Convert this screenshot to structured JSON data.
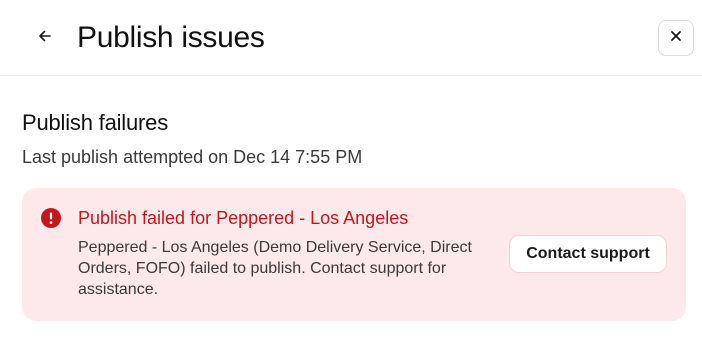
{
  "header": {
    "back_icon": "arrow-left-icon",
    "title": "Publish issues",
    "close_icon": "close-icon"
  },
  "section": {
    "title": "Publish failures",
    "subtitle": "Last publish attempted on Dec 14 7:55 PM"
  },
  "alert": {
    "icon": "error-circle-icon",
    "title": "Publish failed for Peppered - Los Angeles",
    "message": "Peppered - Los Angeles (Demo Delivery Service, Direct Orders, FOFO) failed to publish. Contact support for assistance.",
    "action_label": "Contact support"
  },
  "colors": {
    "alert_background": "#fde9ea",
    "alert_accent": "#c4161c"
  }
}
